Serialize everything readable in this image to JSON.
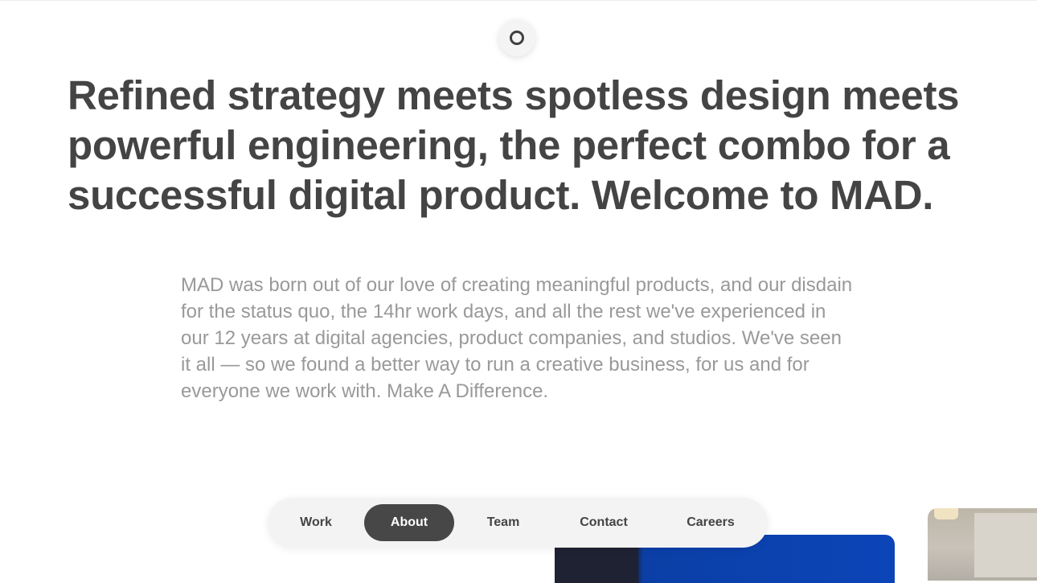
{
  "headline": "Refined strategy meets spotless design meets powerful engineering, the perfect combo for a successful digital product. Welcome to MAD.",
  "intro": "MAD was born out of our love of creating meaningful products, and our disdain for the status quo, the 14hr work days, and all the rest we've experienced in our 12 years at digital agencies, product companies, and studios. We've seen it all — so we found a better way to run a creative business, for us and for everyone we work with. Make A Difference.",
  "logo": {
    "icon": "circle-logo-icon"
  },
  "nav": {
    "active": "About",
    "items": [
      {
        "label": "Work"
      },
      {
        "label": "About"
      },
      {
        "label": "Team"
      },
      {
        "label": "Contact"
      },
      {
        "label": "Careers"
      }
    ]
  },
  "colors": {
    "text_dark": "#444444",
    "text_muted": "#999999",
    "nav_background": "#f3f3f3",
    "nav_active": "#474747",
    "card_blue": "#0c45b8"
  }
}
